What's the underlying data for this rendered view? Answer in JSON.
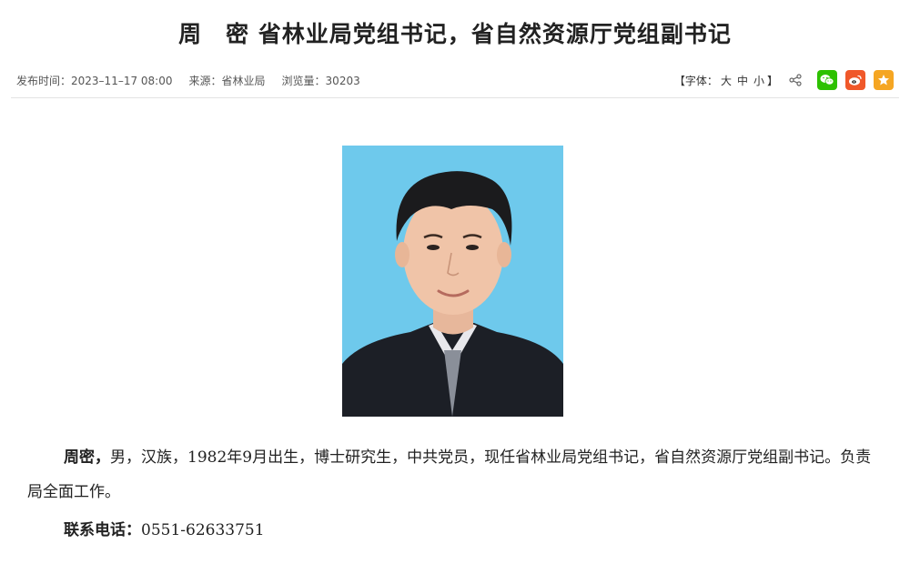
{
  "article": {
    "title": "周　密 省林业局党组书记，省自然资源厅党组副书记",
    "publish_time_label": "发布时间：",
    "publish_time": "2023–11–17 08:00",
    "source_label": "来源：",
    "source": "省林业局",
    "views_label": "浏览量：",
    "views": "30203"
  },
  "toolbar": {
    "font_size_open": "【字体：",
    "font_large": "大",
    "font_medium": "中",
    "font_small": "小",
    "font_size_close": "】"
  },
  "share": {
    "icons": [
      "share-icon",
      "wechat-icon",
      "weibo-icon",
      "favorite-star-icon"
    ],
    "colors": {
      "wechat": "#2dc100",
      "weibo": "#f0582a",
      "favorite": "#f5a623"
    }
  },
  "bio": {
    "name": "周密，",
    "text": "男，汉族，1982年9月出生，博士研究生，中共党员，现任省林业局党组书记，省自然资源厅党组副书记。负责局全面工作。",
    "contact_label": "联系电话：",
    "contact_value": "0551-62633751"
  }
}
